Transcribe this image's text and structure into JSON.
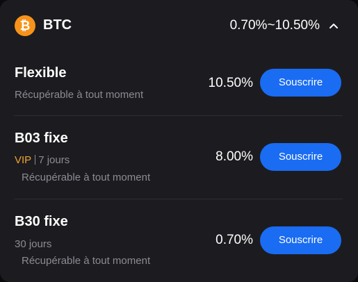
{
  "header": {
    "coin_icon": "bitcoin-icon",
    "coin_name": "BTC",
    "rate_range": "0.70%~10.50%",
    "toggle_icon": "chevron-up-icon"
  },
  "colors": {
    "card_bg": "#1c1c20",
    "accent_button": "#1a6cf2",
    "bitcoin_orange": "#f7931a",
    "vip_orange": "#f0a330",
    "muted_text": "#8b8b93"
  },
  "products": [
    {
      "name": "Flexible",
      "line1": "Récupérable à tout moment",
      "rate": "10.50%",
      "button": "Souscrire"
    },
    {
      "name": "B03 fixe",
      "vip": "VIP",
      "term": "7 jours",
      "line2": "Récupérable à tout moment",
      "rate": "8.00%",
      "button": "Souscrire"
    },
    {
      "name": "B30 fixe",
      "term": "30 jours",
      "line2": "Récupérable à tout moment",
      "rate": "0.70%",
      "button": "Souscrire"
    }
  ]
}
